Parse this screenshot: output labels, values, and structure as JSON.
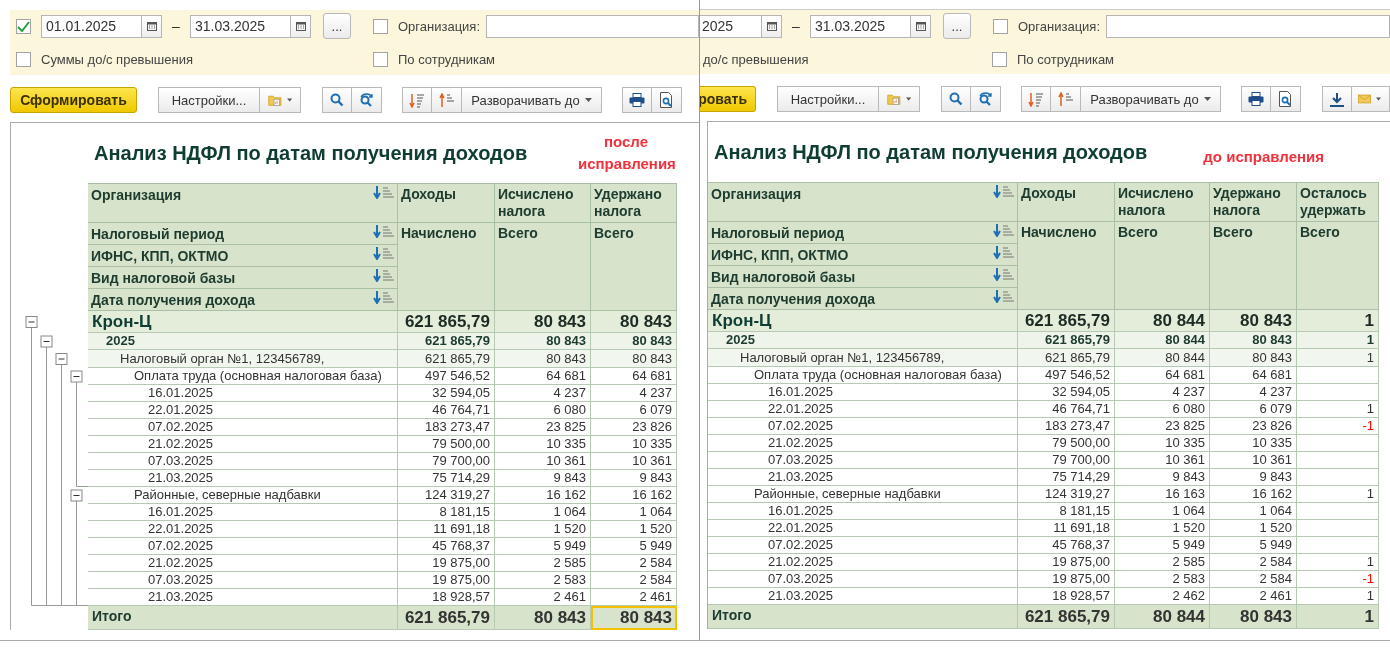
{
  "windows": [
    {
      "kind": "front",
      "filters": {
        "period_checked": true,
        "date_from": "01.01.2025",
        "dash": "–",
        "date_to": "31.03.2025",
        "more_button": "...",
        "organization": {
          "label": "Организация:",
          "checked": false
        },
        "excess": {
          "label": "Суммы до/с превышения",
          "checked": false
        },
        "by_employees": {
          "label": "По сотрудникам",
          "checked": false
        }
      },
      "toolbar": {
        "generate_button": "Сформировать",
        "settings_button": "Настройки...",
        "expand_button": "Разворачивать до"
      },
      "report": {
        "title": "Анализ НДФЛ по датам получения доходов",
        "note": "после исправления",
        "row_headers": [
          "Организация",
          "Налоговый период",
          "ИФНС, КПП, ОКТМО",
          "Вид налоговой базы",
          "Дата получения дохода"
        ],
        "columns": [
          {
            "top": "Доходы",
            "sub": "Начислено"
          },
          {
            "top": "Исчислено налога",
            "sub": "Всего"
          },
          {
            "top": "Удержано налога",
            "sub": "Всего"
          }
        ],
        "rows": [
          {
            "label": "Крон-Ц",
            "values": [
              "621 865,79",
              "80 843",
              "80 843"
            ],
            "expanded": true,
            "children": [
              {
                "label": "2025",
                "values": [
                  "621 865,79",
                  "80 843",
                  "80 843"
                ],
                "expanded": true,
                "children": [
                  {
                    "label": "Налоговый орган №1, 123456789,",
                    "values": [
                      "621 865,79",
                      "80 843",
                      "80 843"
                    ],
                    "expanded": true,
                    "children": [
                      {
                        "label": "Оплата труда (основная налоговая база)",
                        "values": [
                          "497 546,52",
                          "64 681",
                          "64 681"
                        ],
                        "expanded": true,
                        "children": [
                          {
                            "label": "16.01.2025",
                            "values": [
                              "32 594,05",
                              "4 237",
                              "4 237"
                            ]
                          },
                          {
                            "label": "22.01.2025",
                            "values": [
                              "46 764,71",
                              "6 080",
                              "6 079"
                            ]
                          },
                          {
                            "label": "07.02.2025",
                            "values": [
                              "183 273,47",
                              "23 825",
                              "23 826"
                            ]
                          },
                          {
                            "label": "21.02.2025",
                            "values": [
                              "79 500,00",
                              "10 335",
                              "10 335"
                            ]
                          },
                          {
                            "label": "07.03.2025",
                            "values": [
                              "79 700,00",
                              "10 361",
                              "10 361"
                            ]
                          },
                          {
                            "label": "21.03.2025",
                            "values": [
                              "75 714,29",
                              "9 843",
                              "9 843"
                            ]
                          }
                        ]
                      },
                      {
                        "label": "Районные, северные надбавки",
                        "values": [
                          "124 319,27",
                          "16 162",
                          "16 162"
                        ],
                        "expanded": true,
                        "children": [
                          {
                            "label": "16.01.2025",
                            "values": [
                              "8 181,15",
                              "1 064",
                              "1 064"
                            ]
                          },
                          {
                            "label": "22.01.2025",
                            "values": [
                              "11 691,18",
                              "1 520",
                              "1 520"
                            ]
                          },
                          {
                            "label": "07.02.2025",
                            "values": [
                              "45 768,37",
                              "5 949",
                              "5 949"
                            ]
                          },
                          {
                            "label": "21.02.2025",
                            "values": [
                              "19 875,00",
                              "2 585",
                              "2 584"
                            ]
                          },
                          {
                            "label": "07.03.2025",
                            "values": [
                              "19 875,00",
                              "2 583",
                              "2 584"
                            ]
                          },
                          {
                            "label": "21.03.2025",
                            "values": [
                              "18 928,57",
                              "2 461",
                              "2 461"
                            ]
                          }
                        ]
                      }
                    ]
                  }
                ]
              }
            ]
          }
        ],
        "total": {
          "label": "Итого",
          "cells": [
            {
              "text": "621 865,79",
              "selected": false
            },
            {
              "text": "80 843",
              "selected": false
            },
            {
              "text": "80 843",
              "selected": true
            }
          ]
        }
      }
    },
    {
      "kind": "back",
      "filters": {
        "date_from": "2025",
        "dash": "–",
        "date_to": "31.03.2025",
        "more_button": "...",
        "organization": {
          "label": "Организация:",
          "checked": false
        },
        "excess": {
          "label": "до/с превышения"
        },
        "by_employees": {
          "label": "По сотрудникам",
          "checked": false
        }
      },
      "toolbar": {
        "generate_button": "ровать",
        "settings_button": "Настройки...",
        "expand_button": "Разворачивать до"
      },
      "report": {
        "title": "Анализ НДФЛ по датам получения доходов",
        "note": "до исправления",
        "row_headers": [
          "Организация",
          "Налоговый период",
          "ИФНС, КПП, ОКТМО",
          "Вид налоговой базы",
          "Дата получения дохода"
        ],
        "columns": [
          {
            "top": "Доходы",
            "sub": "Начислено"
          },
          {
            "top": "Исчислено налога",
            "sub": "Всего"
          },
          {
            "top": "Удержано налога",
            "sub": "Всего"
          },
          {
            "top": "Осталось удержать",
            "sub": "Всего"
          }
        ],
        "rows": [
          {
            "label": "Крон-Ц",
            "values": [
              "621 865,79",
              "80 844",
              "80 843"
            ],
            "remaining": {
              "text": "1",
              "negative": false
            },
            "children": [
              {
                "label": "2025",
                "values": [
                  "621 865,79",
                  "80 844",
                  "80 843"
                ],
                "remaining": {
                  "text": "1",
                  "negative": false
                },
                "children": [
                  {
                    "label": "Налоговый орган №1, 123456789,",
                    "values": [
                      "621 865,79",
                      "80 844",
                      "80 843"
                    ],
                    "remaining": {
                      "text": "1",
                      "negative": false
                    },
                    "children": [
                      {
                        "label": "Оплата труда (основная налоговая база)",
                        "values": [
                          "497 546,52",
                          "64 681",
                          "64 681"
                        ],
                        "children": [
                          {
                            "label": "16.01.2025",
                            "values": [
                              "32 594,05",
                              "4 237",
                              "4 237"
                            ]
                          },
                          {
                            "label": "22.01.2025",
                            "values": [
                              "46 764,71",
                              "6 080",
                              "6 079"
                            ],
                            "remaining": {
                              "text": "1",
                              "negative": false
                            }
                          },
                          {
                            "label": "07.02.2025",
                            "values": [
                              "183 273,47",
                              "23 825",
                              "23 826"
                            ],
                            "remaining": {
                              "text": "-1",
                              "negative": true
                            }
                          },
                          {
                            "label": "21.02.2025",
                            "values": [
                              "79 500,00",
                              "10 335",
                              "10 335"
                            ]
                          },
                          {
                            "label": "07.03.2025",
                            "values": [
                              "79 700,00",
                              "10 361",
                              "10 361"
                            ]
                          },
                          {
                            "label": "21.03.2025",
                            "values": [
                              "75 714,29",
                              "9 843",
                              "9 843"
                            ]
                          }
                        ]
                      },
                      {
                        "label": "Районные, северные надбавки",
                        "values": [
                          "124 319,27",
                          "16 163",
                          "16 162"
                        ],
                        "remaining": {
                          "text": "1",
                          "negative": false
                        },
                        "children": [
                          {
                            "label": "16.01.2025",
                            "values": [
                              "8 181,15",
                              "1 064",
                              "1 064"
                            ]
                          },
                          {
                            "label": "22.01.2025",
                            "values": [
                              "11 691,18",
                              "1 520",
                              "1 520"
                            ]
                          },
                          {
                            "label": "07.02.2025",
                            "values": [
                              "45 768,37",
                              "5 949",
                              "5 949"
                            ]
                          },
                          {
                            "label": "21.02.2025",
                            "values": [
                              "19 875,00",
                              "2 585",
                              "2 584"
                            ],
                            "remaining": {
                              "text": "1",
                              "negative": false
                            }
                          },
                          {
                            "label": "07.03.2025",
                            "values": [
                              "19 875,00",
                              "2 583",
                              "2 584"
                            ],
                            "remaining": {
                              "text": "-1",
                              "negative": true
                            }
                          },
                          {
                            "label": "21.03.2025",
                            "values": [
                              "18 928,57",
                              "2 462",
                              "2 461"
                            ],
                            "remaining": {
                              "text": "1",
                              "negative": false
                            }
                          }
                        ]
                      }
                    ]
                  }
                ]
              }
            ]
          }
        ],
        "total": {
          "label": "Итого",
          "cells": [
            {
              "text": "621 865,79",
              "selected": false
            },
            {
              "text": "80 844",
              "selected": false
            },
            {
              "text": "80 843",
              "selected": false
            },
            {
              "text": "1",
              "selected": false
            }
          ]
        }
      }
    }
  ]
}
